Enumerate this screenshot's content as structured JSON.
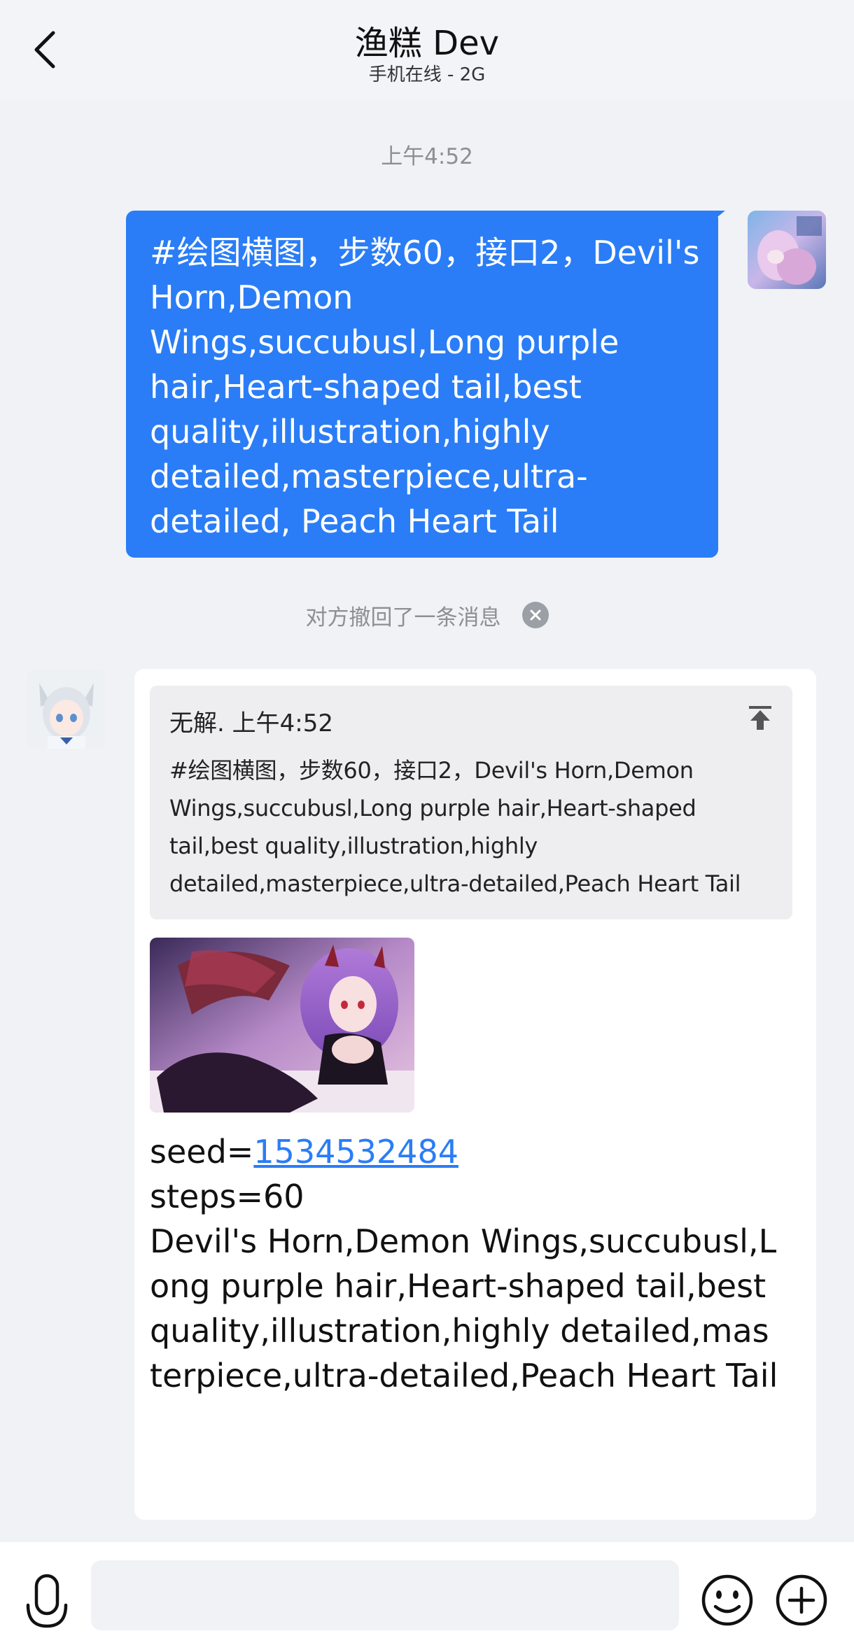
{
  "header": {
    "title": "渔糕 Dev",
    "subtitle": "手机在线 - 2G"
  },
  "timestamp": "上午4:52",
  "outgoing_message": {
    "text": "#绘图横图，步数60，接口2，Devil's Horn,Demon Wings,succubusl,Long purple hair,Heart-shaped tail,best quality,illustration,highly detailed,masterpiece,ultra-detailed, Peach Heart Tail"
  },
  "recall_notice": "对方撤回了一条消息",
  "incoming_message": {
    "quote": {
      "header": "无解. 上午4:52",
      "text": "#绘图横图，步数60，接口2，Devil's Horn,Demon Wings,succubusl,Long purple hair,Heart-shaped tail,best quality,illustration,highly detailed,masterpiece,ultra-detailed,Peach Heart Tail"
    },
    "seed_label": "seed=",
    "seed_value": "1534532484",
    "steps": "steps=60",
    "prompt": "Devil's Horn,Demon Wings,succubusl,Long purple hair,Heart-shaped tail,best quality,illustration,highly detailed,masterpiece,ultra-detailed,Peach Heart Tail"
  },
  "input": {
    "placeholder": ""
  },
  "icons": {
    "back": "chevron-left-icon",
    "recall_close": "close-circle-icon",
    "pin": "pin-top-icon",
    "mic": "microphone-icon",
    "emoji": "smiley-icon",
    "plus": "plus-circle-icon"
  },
  "colors": {
    "accent": "#2a7df6",
    "background": "#f1f2f6",
    "bubble_in": "#ffffff",
    "quote_bg": "#eeedf0"
  }
}
